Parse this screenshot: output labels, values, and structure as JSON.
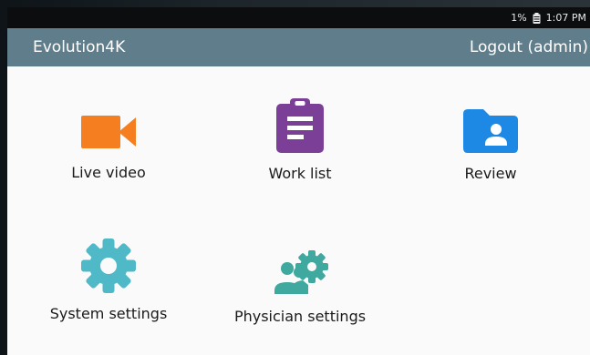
{
  "status_bar": {
    "battery_percent": "1%",
    "time": "1:07 PM",
    "battery_icon": "battery-icon"
  },
  "app_bar": {
    "title": "Evolution4K",
    "logout_label": "Logout (admin)"
  },
  "tiles": [
    {
      "label": "Live video",
      "icon": "videocam-icon",
      "color": "#f57f20"
    },
    {
      "label": "Work list",
      "icon": "assignment-icon",
      "color": "#7b3f98"
    },
    {
      "label": "Review",
      "icon": "folder-user-icon",
      "color": "#1e88e5"
    },
    {
      "label": "System settings",
      "icon": "gear-icon",
      "color": "#4fb9c8"
    },
    {
      "label": "Physician settings",
      "icon": "people-gear-icon",
      "color": "#3fa99f"
    }
  ]
}
